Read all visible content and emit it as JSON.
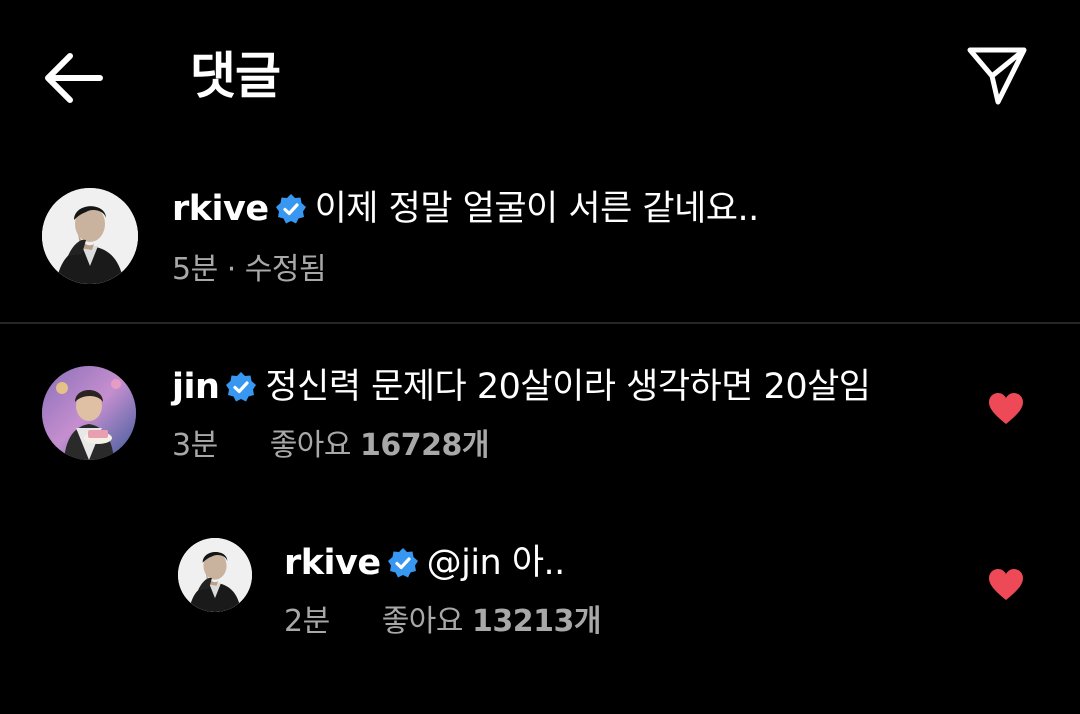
{
  "header": {
    "title": "댓글",
    "back_icon": "arrow-left-icon",
    "share_icon": "paper-plane-icon"
  },
  "colors": {
    "background": "#000000",
    "text": "#ffffff",
    "secondary_text": "#a8a8a8",
    "verified_badge": "#3897f0",
    "heart": "#ed4956",
    "divider": "#262626"
  },
  "caption": {
    "username": "rkive",
    "verified": true,
    "text": "이제 정말 얼굴이 서른 같네요..",
    "meta": "5분 · 수정됨"
  },
  "comments": [
    {
      "username": "jin",
      "verified": true,
      "text": "정신력 문제다 20살이라 생각하면 20살임",
      "time": "3분",
      "likes_prefix": "좋아요 ",
      "likes_count": "16728개",
      "liked": true
    }
  ],
  "replies": [
    {
      "username": "rkive",
      "verified": true,
      "text": "@jin 아..",
      "time": "2분",
      "likes_prefix": "좋아요 ",
      "likes_count": "13213개",
      "liked": true
    }
  ]
}
